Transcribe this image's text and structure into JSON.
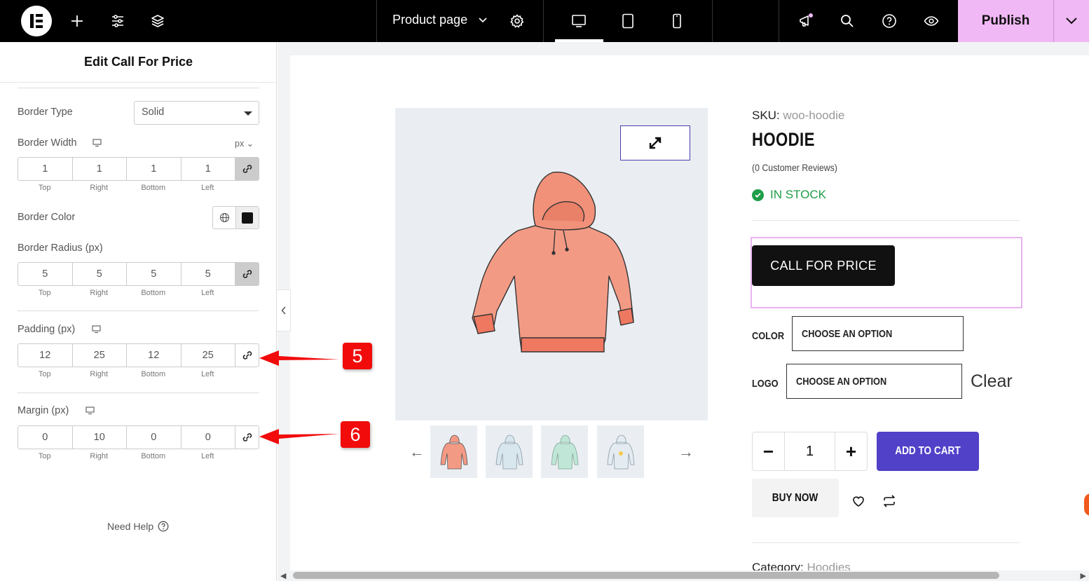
{
  "topbar": {
    "page_title": "Product page",
    "publish_label": "Publish"
  },
  "panel": {
    "title": "Edit Call For Price",
    "border_type": {
      "label": "Border Type",
      "value": "Solid"
    },
    "border_width": {
      "label": "Border Width",
      "unit": "px",
      "values": [
        "1",
        "1",
        "1",
        "1"
      ]
    },
    "border_color": {
      "label": "Border Color",
      "value": "#111111"
    },
    "border_radius": {
      "label": "Border Radius (px)",
      "values": [
        "5",
        "5",
        "5",
        "5"
      ]
    },
    "padding": {
      "label": "Padding (px)",
      "values": [
        "12",
        "25",
        "12",
        "25"
      ]
    },
    "margin": {
      "label": "Margin (px)",
      "values": [
        "0",
        "10",
        "0",
        "0"
      ]
    },
    "side_labels": [
      "Top",
      "Right",
      "Bottom",
      "Left"
    ],
    "need_help": "Need Help"
  },
  "product": {
    "sku_label": "SKU:",
    "sku_value": "woo-hoodie",
    "title": "HOODIE",
    "reviews": "(0 Customer Reviews)",
    "stock": "IN STOCK",
    "call_for_price": "CALL FOR PRICE",
    "color_label": "COLOR",
    "logo_label": "LOGO",
    "choose_option": "CHOOSE AN OPTION",
    "clear": "Clear",
    "quantity": "1",
    "minus": "−",
    "plus": "+",
    "add_to_cart": "ADD TO CART",
    "buy_now": "BUY NOW",
    "category_label": "Category:",
    "category_value": "Hoodies"
  },
  "callouts": [
    "5",
    "6"
  ],
  "colors": {
    "publish_bg": "#f0b8f4",
    "add_to_cart_bg": "#5141c8",
    "stock_green": "#1f9d48",
    "callout_red": "#f20b0b"
  }
}
